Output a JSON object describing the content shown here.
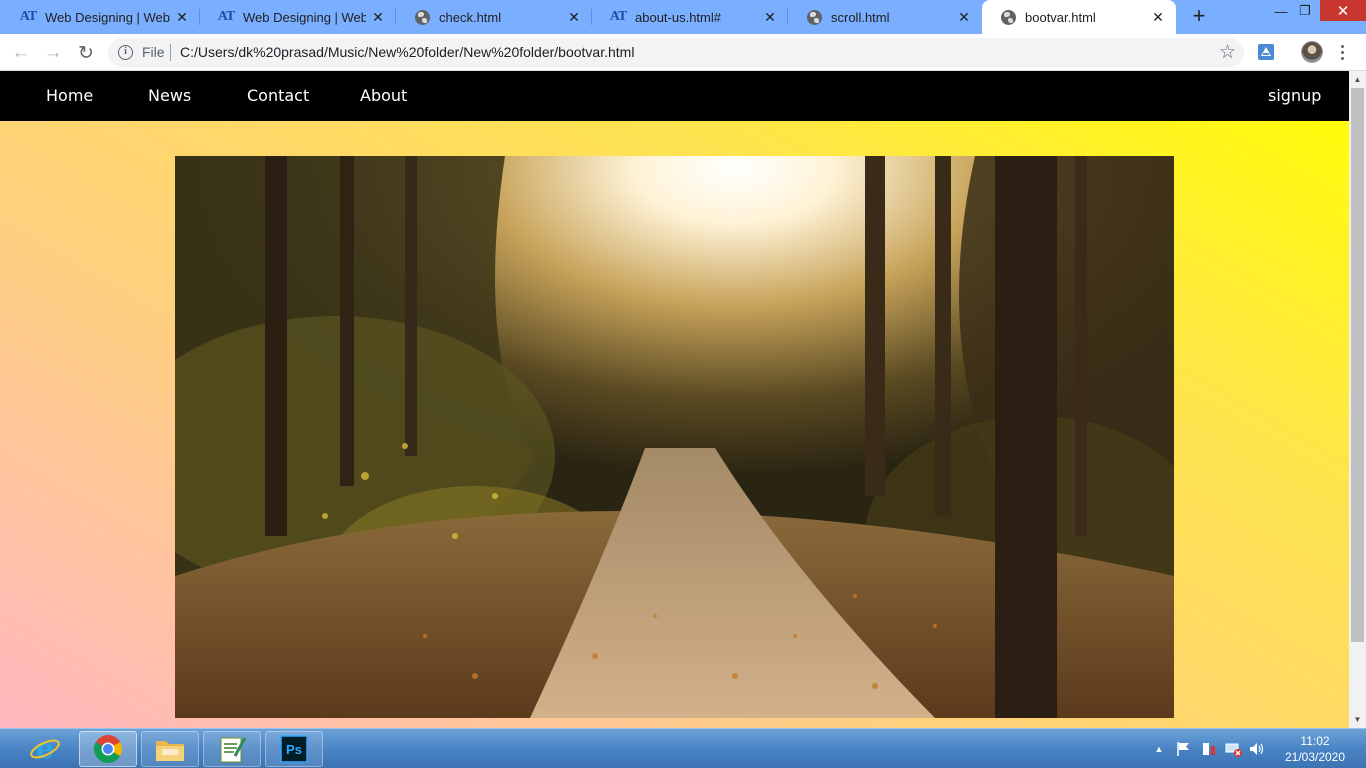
{
  "browser": {
    "tabs": [
      {
        "title": "Web Designing | Website",
        "favicon": "at-logo-icon",
        "active": false
      },
      {
        "title": "Web Designing | Website",
        "favicon": "at-logo-icon",
        "active": false
      },
      {
        "title": "check.html",
        "favicon": "globe-icon",
        "active": false
      },
      {
        "title": "about-us.html#",
        "favicon": "at-logo-icon",
        "active": false
      },
      {
        "title": "scroll.html",
        "favicon": "globe-icon",
        "active": false
      },
      {
        "title": "bootvar.html",
        "favicon": "globe-icon",
        "active": true
      }
    ],
    "favicon_text": "AT",
    "new_tab_label": "+",
    "address": {
      "scheme_label": "File",
      "url": "C:/Users/dk%20prasad/Music/New%20folder/New%20folder/bootvar.html"
    }
  },
  "page": {
    "nav": {
      "items": [
        "Home",
        "News",
        "Contact",
        "About"
      ],
      "signup_label": "signup"
    },
    "background_colors": [
      "#ffb8c0",
      "#ffcf80",
      "#ffe44e",
      "#ffff00"
    ],
    "hero_image": "autumn-forest-path-photo"
  },
  "taskbar": {
    "apps": [
      "internet-explorer-icon",
      "chrome-icon",
      "file-explorer-icon",
      "notepad-icon",
      "photoshop-icon"
    ],
    "photoshop_label": "Ps",
    "clock": {
      "time": "11:02",
      "date": "21/03/2020"
    }
  }
}
